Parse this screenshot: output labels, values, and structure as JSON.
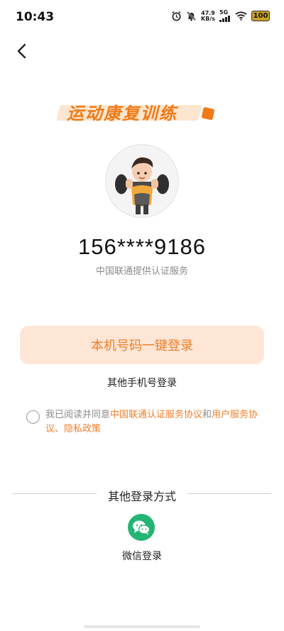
{
  "status_bar": {
    "time": "10:43",
    "net_speed_value": "47.9",
    "net_speed_unit": "KB/s",
    "signal_label": "5G",
    "battery": "100"
  },
  "banner": {
    "title": "运动康复训练"
  },
  "account": {
    "phone_masked": "156****9186",
    "provider_note": "中国联通提供认证服务"
  },
  "actions": {
    "one_click_login": "本机号码一键登录",
    "other_phone_login": "其他手机号登录"
  },
  "agreement": {
    "prefix": "我已阅读并同意",
    "link_unicom": "中国联通认证服务协议",
    "and": "和",
    "link_user": "用户服务协议",
    "sep": "、",
    "link_privacy": "隐私政策"
  },
  "other_login": {
    "title": "其他登录方式",
    "wechat_label": "微信登录"
  },
  "colors": {
    "accent": "#ef7f2a",
    "button_bg": "#fde6d6",
    "wechat": "#22b573"
  }
}
